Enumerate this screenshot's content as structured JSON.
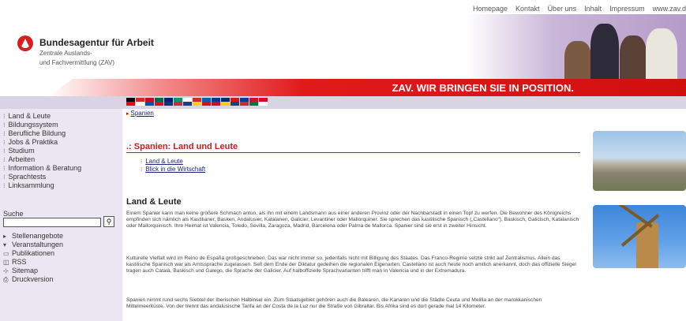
{
  "topnav": [
    "Homepage",
    "Kontakt",
    "Über uns",
    "Inhalt",
    "Impressum",
    "www.zav.d"
  ],
  "brand": {
    "name": "Bundesagentur für Arbeit",
    "sub1": "Zentrale Auslands-",
    "sub2": "und Fachvermittlung (ZAV)"
  },
  "banner": {
    "slogan": "ZAV. WIR BRINGEN SIE IN POSITION."
  },
  "colors": {
    "accent_red": "#d20f0f",
    "nav_purple": "#6a4fa0",
    "left_bg": "#ebe7f2"
  },
  "flag_colors": [
    "#000000",
    "#e30613",
    "#d52b1e",
    "#ffffff",
    "#c60b1e",
    "#0055a4",
    "#006a44",
    "#d21034",
    "#012169",
    "#003580",
    "#00966e",
    "#ce2b37",
    "#ffffff",
    "#1a3d8f",
    "#d52b1e",
    "#fcd116",
    "#0064b0",
    "#e30a17",
    "#003893",
    "#c8102e",
    "#002f6c",
    "#ffce00",
    "#d7141a",
    "#11457e",
    "#0039a6",
    "#d52b1e",
    "#ce1126",
    "#007a3d",
    "#e4002b",
    "#ffffff"
  ],
  "left_nav": [
    "Land & Leute",
    "Bildungssystem",
    "Berufliche Bildung",
    "Jobs & Praktika",
    "Studium",
    "Arbeiten",
    "Information & Beratung",
    "Sprachtests",
    "Linksammlung"
  ],
  "search": {
    "label": "Suche",
    "value": "",
    "button_icon": "magnifier-icon"
  },
  "tools": [
    {
      "icon": "arrow-right-icon",
      "label": "Stellenangebote"
    },
    {
      "icon": "arrow-down-icon",
      "label": "Veranstaltungen"
    },
    {
      "icon": "document-icon",
      "label": "Publikationen"
    },
    {
      "icon": "rss-icon",
      "label": "RSS"
    },
    {
      "icon": "sitemap-icon",
      "label": "Sitemap"
    },
    {
      "icon": "print-icon",
      "label": "Druckversion"
    }
  ],
  "breadcrumb": "Spanien",
  "section_title": "Spanien: Land und Leute",
  "sublinks": [
    "Land & Leute",
    "Blick in die Wirtschaft"
  ],
  "heading": "Land & Leute",
  "paragraphs": [
    "Einem Spanier kann man keine größere Schmach antun, als ihn mit einem Landsmann aus einer anderen Provinz oder der Nachbarstadt in einen Topf zu werfen. Die Bewohner des Königreichs empfinden sich nämlich als Kastilianer, Basken, Andalusier, Katalanen, Galicier, Levantiner oder Mallorquiner. Sie sprechen das kastilische Spanisch („Castellano“), Baskisch, Galicisch, Katalanisch oder Mallorquinisch. Ihre Heimat ist Valencia, Toledo, Sevilla, Zaragoza, Madrid, Barcelona oder Palma de Mallorca. Spanier sind sie erst in zweiter Hinsicht.",
    "Kulturelle Vielfalt wird im Reino de España großgeschrieben. Das war nicht immer so, jedenfalls nicht mit Billigung des Staates. Das Franco-Regime setzte strikt auf Zentralismus. Allein das kastilische Spanisch war als Amtssprache zugelassen. Seit dem Ende der Diktatur gedeihen die regionalen Eigenarten. Castellano ist auch heute noch amtlich anerkannt, doch das offizielle Siegel tragen auch Català, Baskisch und Galego, die Sprache der Galicier. Auf halboffizielle Sprachvarianten trifft man in Valencia und in der Extremadura.",
    "Spanien nimmt rund sechs Siebtel der Iberischen Halbinsel ein. Zum Staatsgebiet gehören auch die Balearen, die Kanaren und die Städte Ceuta und Melilla an der marokkanischen Mittelmeerküste. Von der trennt das andalusische Tarifa an der Costa de la Luz nur die Straße von Gibraltar. Bis Afrika sind es dort gerade mal 14 Kilometer."
  ]
}
